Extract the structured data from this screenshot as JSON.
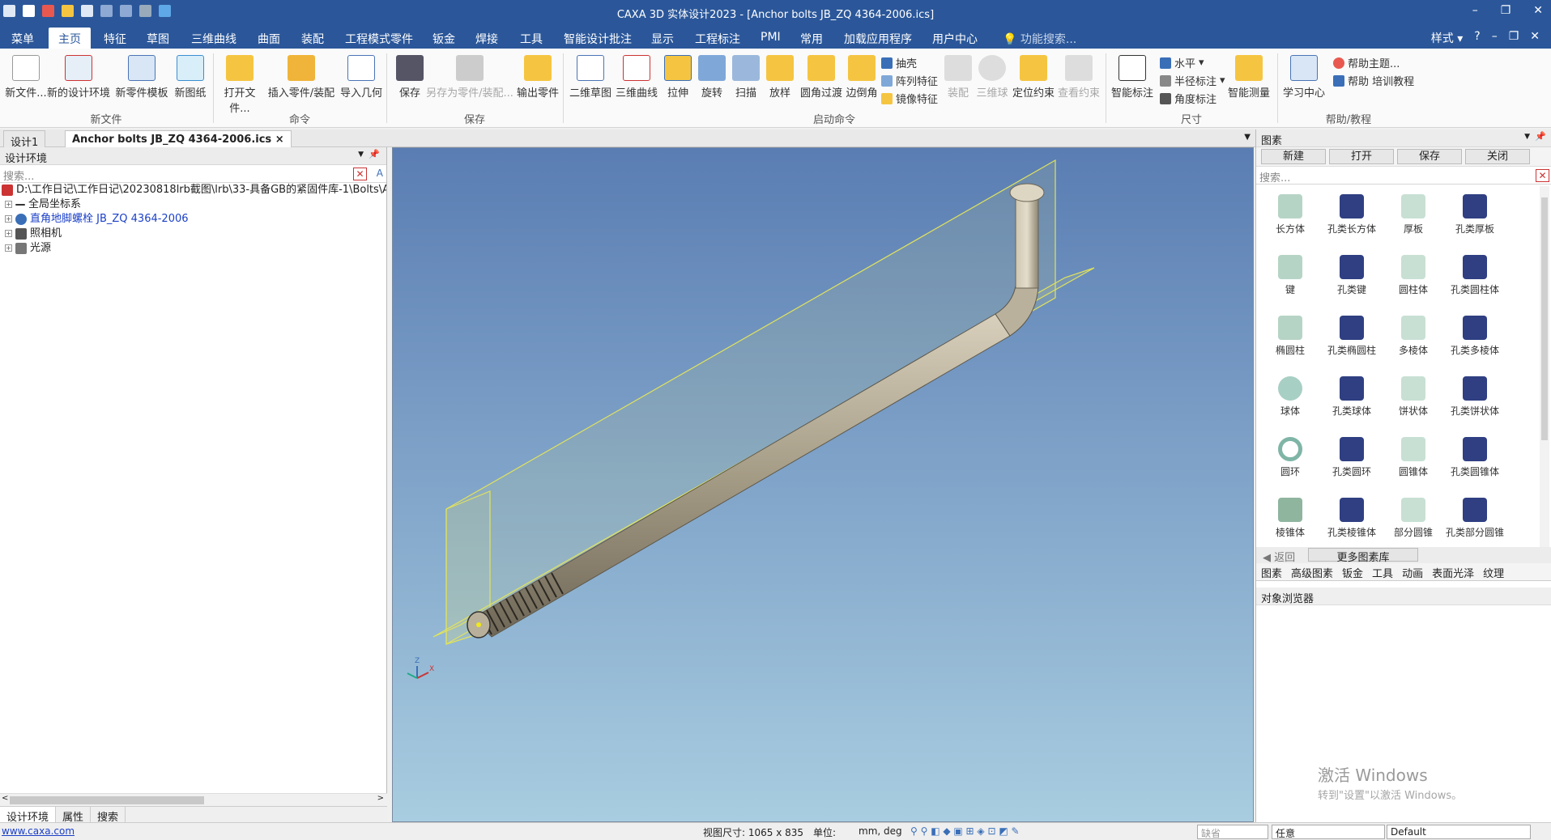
{
  "app": {
    "title": "CAXA 3D 实体设计2023 - [Anchor bolts JB_ZQ 4364-2006.ics]"
  },
  "menus": [
    "菜单",
    "主页",
    "特征",
    "草图",
    "三维曲线",
    "曲面",
    "装配",
    "工程模式零件",
    "钣金",
    "焊接",
    "工具",
    "智能设计批注",
    "显示",
    "工程标注",
    "PMI",
    "常用",
    "加载应用程序",
    "用户中心"
  ],
  "menu_search": "功能搜索...",
  "style_label": "样式",
  "ribbon": {
    "groups": [
      "新文件",
      "命令",
      "保存",
      "启动命令",
      "尺寸",
      "帮助/教程"
    ],
    "new": [
      "新文件...",
      "新的设计环境",
      "新零件模板",
      "新图纸"
    ],
    "cmd": [
      "打开文件...",
      "插入零件/装配",
      "导入几何"
    ],
    "save": [
      "保存",
      "另存为零件/装配...",
      "输出零件"
    ],
    "launch": [
      "二维草图",
      "三维曲线",
      "拉伸",
      "旋转",
      "扫描",
      "放样",
      "圆角过渡",
      "边倒角"
    ],
    "small": [
      "抽壳",
      "阵列特征",
      "镜像特征"
    ],
    "launch2": [
      "装配",
      "三维球",
      "定位约束",
      "查看约束"
    ],
    "dim_big": "智能标注",
    "dim_small": [
      "水平",
      "半径标注",
      "角度标注"
    ],
    "measure": "智能测量",
    "help_big": "学习中心",
    "help_small": [
      "帮助主题...",
      "帮助 培训教程"
    ]
  },
  "tabs": [
    "设计1",
    "Anchor bolts JB_ZQ 4364-2006.ics"
  ],
  "left": {
    "header": "设计环境",
    "search_ph": "搜索...",
    "path": "D:\\工作日记\\工作日记\\20230818lrb截图\\lrb\\33-具备GB的紧固件库-1\\Bolts\\Ancho",
    "items": [
      "全局坐标系",
      "直角地脚螺栓 JB_ZQ 4364-2006",
      "照相机",
      "光源"
    ],
    "bottom_tabs": [
      "设计环境",
      "属性",
      "搜索"
    ]
  },
  "right": {
    "header": "图素",
    "buttons": [
      "新建",
      "打开",
      "保存",
      "关闭"
    ],
    "search_ph": "搜索...",
    "shapes": [
      "长方体",
      "孔类长方体",
      "厚板",
      "孔类厚板",
      "键",
      "孔类键",
      "圆柱体",
      "孔类圆柱体",
      "椭圆柱",
      "孔类椭圆柱",
      "多棱体",
      "孔类多棱体",
      "球体",
      "孔类球体",
      "饼状体",
      "孔类饼状体",
      "圆环",
      "孔类圆环",
      "圆锥体",
      "孔类圆锥体",
      "棱锥体",
      "孔类棱锥体",
      "部分圆锥",
      "孔类部分圆锥"
    ],
    "nav": [
      "返回",
      "更多图素库"
    ],
    "tabs": [
      "图素",
      "高级图素",
      "钣金",
      "工具",
      "动画",
      "表面光泽",
      "纹理"
    ],
    "obj_header": "对象浏览器",
    "watermark1": "激活 Windows",
    "watermark2": "转到\"设置\"以激活 Windows。"
  },
  "axes": {
    "z": "Z",
    "x": "X"
  },
  "status": {
    "url": "www.caxa.com",
    "view_size": "视图尺寸: 1065 x  835",
    "unit_label": "单位:",
    "unit_val": "mm, deg",
    "combo1": "缺省",
    "combo2": "任意",
    "combo3": "Default"
  }
}
